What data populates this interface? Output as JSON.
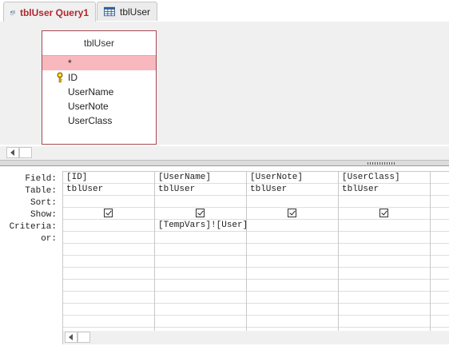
{
  "tabs": [
    {
      "label": "tblUser Query1",
      "icon": "query-icon",
      "active": true
    },
    {
      "label": "tblUser",
      "icon": "table-icon",
      "active": false
    }
  ],
  "table_box": {
    "title": "tblUser",
    "fields": [
      "*",
      "ID",
      "UserName",
      "UserNote",
      "UserClass"
    ],
    "key_field": "ID"
  },
  "grid": {
    "row_labels": [
      "Field:",
      "Table:",
      "Sort:",
      "Show:",
      "Criteria:",
      "or:"
    ],
    "columns": [
      {
        "field": "[ID]",
        "table": "tblUser",
        "sort": "",
        "show": true,
        "criteria": "",
        "or": ""
      },
      {
        "field": "[UserName]",
        "table": "tblUser",
        "sort": "",
        "show": true,
        "criteria": "[TempVars]![User]",
        "or": ""
      },
      {
        "field": "[UserNote]",
        "table": "tblUser",
        "sort": "",
        "show": true,
        "criteria": "",
        "or": ""
      },
      {
        "field": "[UserClass]",
        "table": "tblUser",
        "sort": "",
        "show": true,
        "criteria": "",
        "or": ""
      },
      {
        "field": "",
        "table": "",
        "sort": "",
        "show": false,
        "criteria": "",
        "or": ""
      }
    ]
  },
  "colors": {
    "star_highlight": "#f8b8bd",
    "table_border": "#a14a51",
    "active_tab_text": "#b3272d"
  }
}
